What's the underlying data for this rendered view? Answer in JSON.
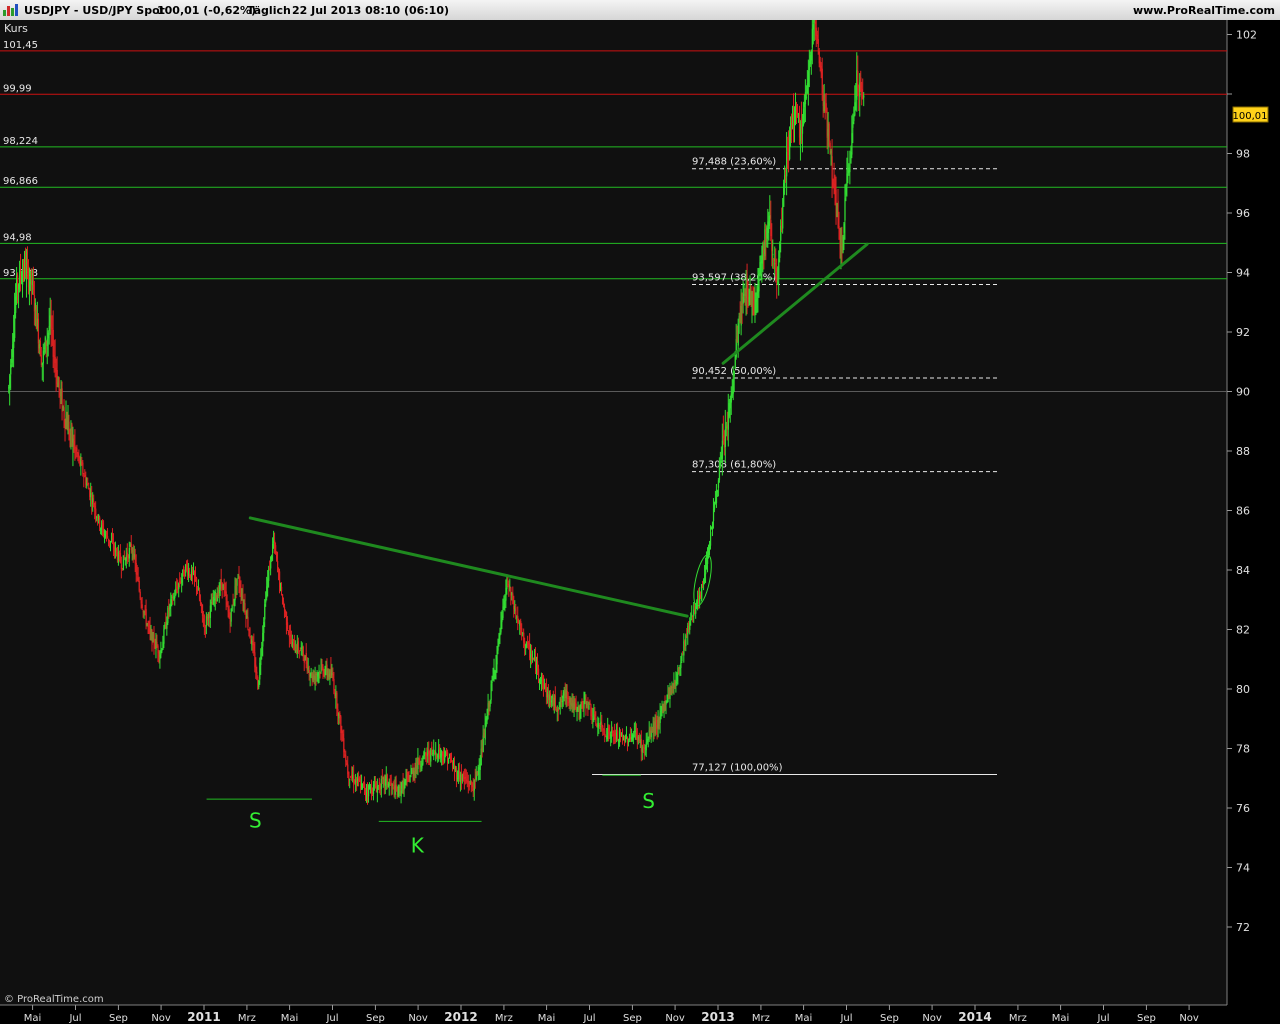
{
  "header": {
    "symbol": "USDJPY - USD/JPY Spot",
    "quote": "100,01 (-0,62%)",
    "period": "Täglich",
    "datetime": "22 Jul 2013 08:10 (06:10)",
    "site": "www.ProRealTime.com"
  },
  "footer": {
    "copyright": "© ProRealTime.com"
  },
  "colors": {
    "up": "#33dd33",
    "down": "#dd2222",
    "resistance": "#cc1111",
    "support": "#22bb22",
    "trendline": "#1f8a1f",
    "grid": "#2c2c2c",
    "background": "#101010",
    "price_tag": "#ffd21a"
  },
  "chart_data": {
    "type": "candlestick",
    "panel_label": "Kurs",
    "current_price_tag": "100,01",
    "y_ticks": [
      72,
      74,
      76,
      78,
      80,
      82,
      84,
      86,
      88,
      90,
      92,
      94,
      96,
      98,
      100,
      102
    ],
    "y_tick_labels": [
      "72",
      "74",
      "76",
      "78",
      "80",
      "82",
      "84",
      "86",
      "88",
      "90",
      "92",
      "94",
      "96",
      "98",
      "",
      "102"
    ],
    "x_ticks": [
      {
        "label": "Mai",
        "t": 2010.333,
        "major": false
      },
      {
        "label": "Jul",
        "t": 2010.5,
        "major": false
      },
      {
        "label": "Sep",
        "t": 2010.667,
        "major": false
      },
      {
        "label": "Nov",
        "t": 2010.833,
        "major": false
      },
      {
        "label": "2011",
        "t": 2011.0,
        "major": true
      },
      {
        "label": "Mrz",
        "t": 2011.167,
        "major": false
      },
      {
        "label": "Mai",
        "t": 2011.333,
        "major": false
      },
      {
        "label": "Jul",
        "t": 2011.5,
        "major": false
      },
      {
        "label": "Sep",
        "t": 2011.667,
        "major": false
      },
      {
        "label": "Nov",
        "t": 2011.833,
        "major": false
      },
      {
        "label": "2012",
        "t": 2012.0,
        "major": true
      },
      {
        "label": "Mrz",
        "t": 2012.167,
        "major": false
      },
      {
        "label": "Mai",
        "t": 2012.333,
        "major": false
      },
      {
        "label": "Jul",
        "t": 2012.5,
        "major": false
      },
      {
        "label": "Sep",
        "t": 2012.667,
        "major": false
      },
      {
        "label": "Nov",
        "t": 2012.833,
        "major": false
      },
      {
        "label": "2013",
        "t": 2013.0,
        "major": true
      },
      {
        "label": "Mrz",
        "t": 2013.167,
        "major": false
      },
      {
        "label": "Mai",
        "t": 2013.333,
        "major": false
      },
      {
        "label": "Jul",
        "t": 2013.5,
        "major": false
      },
      {
        "label": "Sep",
        "t": 2013.667,
        "major": false
      },
      {
        "label": "Nov",
        "t": 2013.833,
        "major": false
      },
      {
        "label": "2014",
        "t": 2014.0,
        "major": true
      },
      {
        "label": "Mrz",
        "t": 2014.167,
        "major": false
      },
      {
        "label": "Mai",
        "t": 2014.333,
        "major": false
      },
      {
        "label": "Jul",
        "t": 2014.5,
        "major": false
      },
      {
        "label": "Sep",
        "t": 2014.667,
        "major": false
      },
      {
        "label": "Nov",
        "t": 2014.833,
        "major": false
      }
    ],
    "horizontal_levels": [
      {
        "value": 101.45,
        "label": "101,45",
        "kind": "resistance"
      },
      {
        "value": 99.99,
        "label": "99,99",
        "kind": "resistance"
      },
      {
        "value": 98.224,
        "label": "98,224",
        "kind": "support"
      },
      {
        "value": 96.866,
        "label": "96,866",
        "kind": "support"
      },
      {
        "value": 94.98,
        "label": "94,98",
        "kind": "support"
      },
      {
        "value": 93.788,
        "label": "93,788",
        "kind": "support"
      },
      {
        "value": 90.0,
        "label": "",
        "kind": "grid"
      }
    ],
    "fibonacci": [
      {
        "value": 97.488,
        "label": "97,488 (23,60%)",
        "dashed": true
      },
      {
        "value": 93.597,
        "label": "93,597 (38,20%)",
        "dashed": true
      },
      {
        "value": 90.452,
        "label": "90,452 (50,00%)",
        "dashed": true
      },
      {
        "value": 87.308,
        "label": "87,308 (61,80%)",
        "dashed": true
      },
      {
        "value": 77.127,
        "label": "77,127 (100,00%)",
        "dashed": false
      }
    ],
    "trendlines": [
      {
        "name": "neckline",
        "from": {
          "t": 2011.18,
          "v": 85.75
        },
        "to": {
          "t": 2012.88,
          "v": 82.45
        }
      },
      {
        "name": "support-trend",
        "from": {
          "t": 2013.02,
          "v": 90.95
        },
        "to": {
          "t": 2013.58,
          "v": 94.95
        }
      }
    ],
    "pattern_annotations": [
      {
        "text": "S",
        "t": 2011.2,
        "v": 75.35,
        "baseline_v": 76.3,
        "baseline_t": [
          2011.01,
          2011.42
        ]
      },
      {
        "text": "K",
        "t": 2011.83,
        "v": 74.5,
        "baseline_v": 75.55,
        "baseline_t": [
          2011.68,
          2012.08
        ]
      },
      {
        "text": "S",
        "t": 2012.73,
        "v": 76.0,
        "baseline_v": 77.1,
        "baseline_t": [
          2012.55,
          2012.7
        ]
      }
    ],
    "breakout_marker": {
      "t": 2012.94,
      "v": 83.65
    },
    "price_path": [
      [
        2010.24,
        90.1
      ],
      [
        2010.27,
        93.5
      ],
      [
        2010.3,
        94.2
      ],
      [
        2010.33,
        93.6
      ],
      [
        2010.37,
        91.0
      ],
      [
        2010.4,
        92.3
      ],
      [
        2010.44,
        89.8
      ],
      [
        2010.48,
        88.5
      ],
      [
        2010.52,
        87.5
      ],
      [
        2010.56,
        86.5
      ],
      [
        2010.6,
        85.4
      ],
      [
        2010.64,
        84.9
      ],
      [
        2010.68,
        84.2
      ],
      [
        2010.72,
        84.8
      ],
      [
        2010.75,
        83.2
      ],
      [
        2010.79,
        81.8
      ],
      [
        2010.83,
        81.2
      ],
      [
        2010.86,
        82.6
      ],
      [
        2010.9,
        83.5
      ],
      [
        2010.93,
        84.1
      ],
      [
        2010.97,
        83.6
      ],
      [
        2011.0,
        82.1
      ],
      [
        2011.03,
        82.8
      ],
      [
        2011.07,
        83.6
      ],
      [
        2011.1,
        82.3
      ],
      [
        2011.13,
        83.8
      ],
      [
        2011.16,
        82.7
      ],
      [
        2011.19,
        81.3
      ],
      [
        2011.21,
        80.1
      ],
      [
        2011.24,
        83.2
      ],
      [
        2011.27,
        85.0
      ],
      [
        2011.3,
        83.2
      ],
      [
        2011.34,
        81.5
      ],
      [
        2011.38,
        81.3
      ],
      [
        2011.42,
        80.4
      ],
      [
        2011.46,
        80.7
      ],
      [
        2011.5,
        80.4
      ],
      [
        2011.53,
        78.8
      ],
      [
        2011.56,
        77.2
      ],
      [
        2011.59,
        76.9
      ],
      [
        2011.63,
        76.6
      ],
      [
        2011.67,
        76.7
      ],
      [
        2011.71,
        76.9
      ],
      [
        2011.75,
        76.5
      ],
      [
        2011.79,
        76.9
      ],
      [
        2011.83,
        77.5
      ],
      [
        2011.87,
        77.8
      ],
      [
        2011.91,
        77.9
      ],
      [
        2011.95,
        77.7
      ],
      [
        2011.98,
        77.2
      ],
      [
        2012.02,
        76.9
      ],
      [
        2012.05,
        76.7
      ],
      [
        2012.08,
        77.9
      ],
      [
        2012.11,
        79.6
      ],
      [
        2012.15,
        81.8
      ],
      [
        2012.18,
        83.6
      ],
      [
        2012.21,
        82.6
      ],
      [
        2012.24,
        81.7
      ],
      [
        2012.28,
        81.0
      ],
      [
        2012.31,
        80.4
      ],
      [
        2012.34,
        79.7
      ],
      [
        2012.38,
        79.4
      ],
      [
        2012.41,
        79.9
      ],
      [
        2012.45,
        79.2
      ],
      [
        2012.49,
        79.6
      ],
      [
        2012.52,
        78.9
      ],
      [
        2012.56,
        78.6
      ],
      [
        2012.6,
        78.4
      ],
      [
        2012.64,
        78.3
      ],
      [
        2012.68,
        78.5
      ],
      [
        2012.71,
        77.9
      ],
      [
        2012.74,
        78.6
      ],
      [
        2012.77,
        78.9
      ],
      [
        2012.8,
        79.7
      ],
      [
        2012.84,
        80.4
      ],
      [
        2012.87,
        81.6
      ],
      [
        2012.9,
        82.6
      ],
      [
        2012.93,
        83.0
      ],
      [
        2012.96,
        84.6
      ],
      [
        2012.99,
        86.4
      ],
      [
        2013.02,
        88.2
      ],
      [
        2013.05,
        89.6
      ],
      [
        2013.08,
        92.3
      ],
      [
        2013.11,
        93.5
      ],
      [
        2013.14,
        92.9
      ],
      [
        2013.17,
        94.6
      ],
      [
        2013.2,
        95.8
      ],
      [
        2013.23,
        93.4
      ],
      [
        2013.26,
        97.3
      ],
      [
        2013.29,
        99.3
      ],
      [
        2013.32,
        98.8
      ],
      [
        2013.35,
        100.2
      ],
      [
        2013.37,
        102.7
      ],
      [
        2013.39,
        101.5
      ],
      [
        2013.41,
        99.9
      ],
      [
        2013.44,
        97.8
      ],
      [
        2013.46,
        96.1
      ],
      [
        2013.48,
        94.6
      ],
      [
        2013.5,
        96.9
      ],
      [
        2013.52,
        98.5
      ],
      [
        2013.54,
        100.7
      ],
      [
        2013.56,
        99.8
      ],
      [
        2013.57,
        100.01
      ]
    ]
  }
}
